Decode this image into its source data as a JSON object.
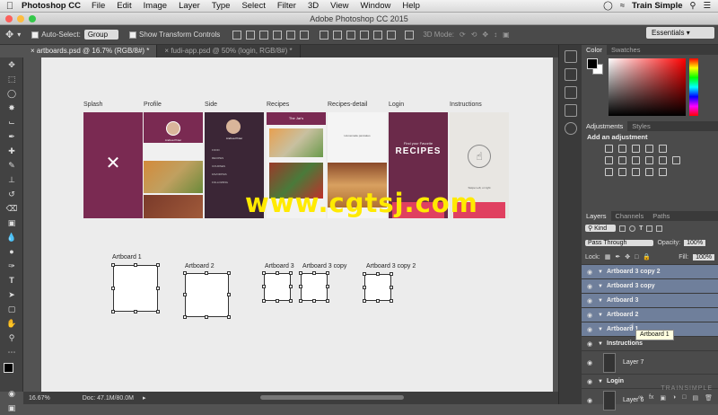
{
  "menubar": {
    "apple_icon": "apple-icon",
    "app_name": "Photoshop CC",
    "items": [
      "File",
      "Edit",
      "Image",
      "Layer",
      "Type",
      "Select",
      "Filter",
      "3D",
      "View",
      "Window",
      "Help"
    ],
    "right_label": "Train Simple"
  },
  "window": {
    "title": "Adobe Photoshop CC 2015",
    "light_colors": [
      "#fc605b",
      "#fdbc40",
      "#34c84a"
    ]
  },
  "options_bar": {
    "auto_select_label": "Auto-Select:",
    "auto_select_value": "Group",
    "show_transform_label": "Show Transform Controls",
    "mode_3d_label": "3D Mode:",
    "workspace": "Essentials"
  },
  "doc_tabs": [
    {
      "label": "artboards.psd @ 16.7% (RGB/8#) *",
      "active": true
    },
    {
      "label": "fudi-app.psd @ 50% (login, RGB/8#) *",
      "active": false
    }
  ],
  "artboards": [
    {
      "label": "Splash",
      "color": "#7a2a52"
    },
    {
      "label": "Profile",
      "color": "#f0f0f0"
    },
    {
      "label": "Side",
      "color": "#3b2636"
    },
    {
      "label": "Recipes",
      "color": "#f2f2f2"
    },
    {
      "label": "Recipes-detail",
      "color": "#f4f4f4"
    },
    {
      "label": "Login",
      "color": "#6b2a4a"
    },
    {
      "label": "Instructions",
      "color": "#e8e6e2"
    }
  ],
  "artboard_texts": {
    "profile_name": "Andrea Pinter",
    "side_name": "Andrea Pinter",
    "recipes_title": "The Jar's",
    "detail_title": "Homemade pancakes",
    "login_tagline": "Find your Favorite",
    "login_title": "RECIPES",
    "instructions_text": "Swipe Left, or right"
  },
  "side_menu": [
    "FOOD",
    "RECIPES",
    "COURSES",
    "FAVORITES",
    "FOLLOWING"
  ],
  "empty_artboards": [
    {
      "label": "Artboard 1"
    },
    {
      "label": "Artboard 2"
    },
    {
      "label": "Artboard 3"
    },
    {
      "label": "Artboard 3 copy"
    },
    {
      "label": "Artboard 3 copy 2"
    }
  ],
  "watermark": "www.cgtsj.com",
  "status": {
    "zoom": "16.67%",
    "doc": "Doc: 47.1M/80.0M"
  },
  "panels": {
    "color_tabs": [
      "Color",
      "Swatches"
    ],
    "adjustment_tabs": [
      "Adjustments",
      "Styles"
    ],
    "add_adjustment": "Add an adjustment",
    "layers_tabs": [
      "Layers",
      "Channels",
      "Paths"
    ],
    "kind": "Kind",
    "blend_mode": "Pass Through",
    "opacity_label": "Opacity:",
    "opacity": "100%",
    "lock_label": "Lock:",
    "fill_label": "Fill:",
    "fill": "100%",
    "tooltip": "Artboard 1",
    "watermark_logo": "TRAINSIMPLE"
  },
  "layers": [
    {
      "name": "Artboard 3 copy 2",
      "type": "group",
      "selected": true
    },
    {
      "name": "Artboard 3 copy",
      "type": "group",
      "selected": true
    },
    {
      "name": "Artboard 3",
      "type": "group",
      "selected": true
    },
    {
      "name": "Artboard 2",
      "type": "group",
      "selected": true
    },
    {
      "name": "Artboard 1",
      "type": "group",
      "selected": true
    },
    {
      "name": "Instructions",
      "type": "group",
      "selected": false
    },
    {
      "name": "Layer 7",
      "type": "layer",
      "selected": false
    },
    {
      "name": "Login",
      "type": "group",
      "selected": false
    },
    {
      "name": "Layer 6",
      "type": "layer",
      "selected": false
    }
  ],
  "colors": {
    "selection": "#6f7f9b",
    "panel_bg": "#4b4b4b",
    "watermark": "#ffea00"
  }
}
